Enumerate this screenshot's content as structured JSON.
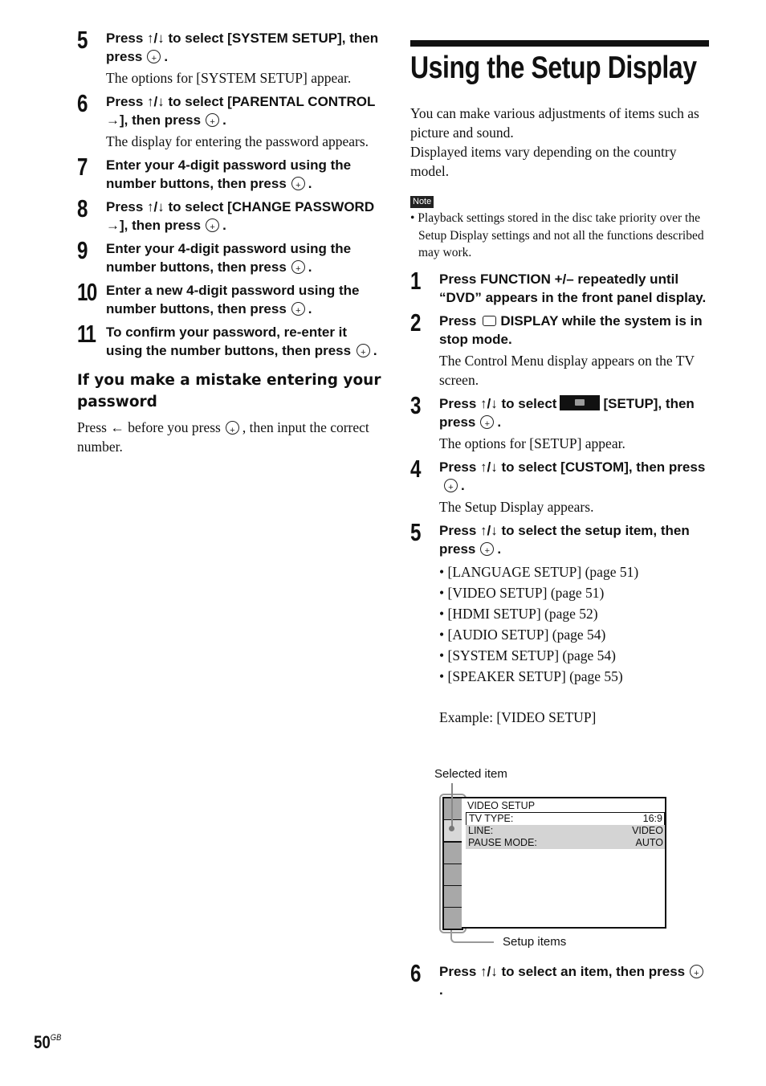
{
  "left": {
    "steps": [
      {
        "num": "5",
        "head_a": "Press ↑/↓ to select [SYSTEM SETUP], then press",
        "body": "The options for [SYSTEM SETUP] appear."
      },
      {
        "num": "6",
        "head_a": "Press ↑/↓ to select [PARENTAL CONTROL →], then press",
        "body": "The display for entering the password appears."
      },
      {
        "num": "7",
        "head_a": "Enter your 4-digit password using the number buttons, then press"
      },
      {
        "num": "8",
        "head_a": "Press ↑/↓ to select [CHANGE PASSWORD →], then press"
      },
      {
        "num": "9",
        "head_a": "Enter your 4-digit password using the number buttons, then press"
      },
      {
        "num": "10",
        "head_a": "Enter a new 4-digit password using the number buttons, then press"
      },
      {
        "num": "11",
        "head_a": "To confirm your password, re-enter it using the number buttons, then press"
      }
    ],
    "mistake": {
      "heading": "If you make a mistake entering your password",
      "text_a": "Press ← before you press",
      "text_b": ", then input the correct number."
    }
  },
  "right": {
    "title": "Using the Setup Display",
    "intro": "You can make various adjustments of items such as picture and sound.",
    "intro2": "Displayed items vary depending on the country model.",
    "note_label": "Note",
    "note": "• Playback settings stored in the disc take priority over the Setup Display settings and not all the functions described may work.",
    "steps": [
      {
        "num": "1",
        "head_a": "Press FUNCTION +/– repeatedly until “DVD” appears in the front panel display."
      },
      {
        "num": "2",
        "head_a": "Press",
        "head_b": "DISPLAY while the system is in stop mode.",
        "body": "The Control Menu display appears on the TV screen."
      },
      {
        "num": "3",
        "head_a": "Press ↑/↓ to select",
        "head_b": "[SETUP], then press",
        "body": "The options for [SETUP] appear."
      },
      {
        "num": "4",
        "head_a": "Press ↑/↓ to select [CUSTOM], then press",
        "body": "The Setup Display appears."
      },
      {
        "num": "5",
        "head_a": "Press ↑/↓ to select the setup item, then press"
      },
      {
        "num": "6",
        "head_a": "Press ↑/↓ to select an item, then press"
      }
    ],
    "setup_items": [
      "• [LANGUAGE SETUP] (page 51)",
      "• [VIDEO SETUP] (page 51)",
      "• [HDMI SETUP] (page 52)",
      "• [AUDIO SETUP] (page 54)",
      "• [SYSTEM SETUP] (page 54)",
      "• [SPEAKER SETUP] (page 55)"
    ],
    "example": "Example: [VIDEO SETUP]"
  },
  "diagram": {
    "selected_label": "Selected item",
    "setup_items_label": "Setup items",
    "screen_title": "VIDEO SETUP",
    "rows": [
      {
        "label": "TV TYPE:",
        "value": "16:9"
      },
      {
        "label": "LINE:",
        "value": "VIDEO"
      },
      {
        "label": "PAUSE MODE:",
        "value": "AUTO"
      }
    ]
  },
  "footer": {
    "page": "50",
    "suffix": "GB"
  }
}
